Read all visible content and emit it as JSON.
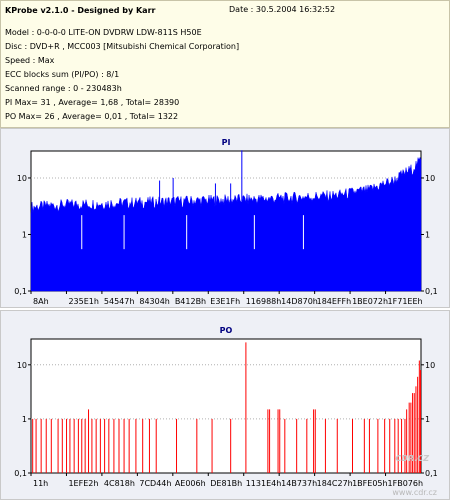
{
  "header": {
    "title": "KProbe v2.1.0 - Designed by Karr",
    "date": "Date : 30.5.2004 16:32:52",
    "model": "Model : 0-0-0-0 LITE-ON DVDRW LDW-811S   H50E",
    "disc": "Disc : DVD+R , MCC003 [Mitsubishi Chemical Corporation]",
    "speed": "Speed : Max",
    "ecc": "ECC blocks sum (PI/PO) : 8/1",
    "range": "Scanned range : 0 - 230483h",
    "pi_stats": "PI Max= 31 , Average= 1,68 , Total= 28390",
    "po_stats": "PO Max= 26 , Average= 0,01 , Total= 1322"
  },
  "watermark": "CDR.CZ",
  "watermark_url": "www.cdr.cz",
  "colors": {
    "pi": "#0000ff",
    "po": "#ff0000",
    "panel_bg": "#eef0f6",
    "plot_bg": "#ffffff",
    "grid": "#b0b0b0"
  },
  "chart_data": [
    {
      "type": "bar",
      "title": "PI",
      "yscale": "log",
      "ylim": [
        0.1,
        30
      ],
      "y_tick_labels": [
        "10",
        "1",
        "0,1"
      ],
      "y_tick_values": [
        10,
        1,
        0.1
      ],
      "x_tick_labels": [
        "8Ah",
        "235E1h",
        "54547h",
        "84304h",
        "B412Bh",
        "E3E1Fh",
        "116988h",
        "14D870h",
        "184EFFh",
        "1BE072h",
        "1F71EEh"
      ],
      "xlim": [
        0,
        230483
      ],
      "profile": [
        {
          "x": 0,
          "y": 3
        },
        {
          "x": 20000,
          "y": 3.3
        },
        {
          "x": 60000,
          "y": 3.6
        },
        {
          "x": 100000,
          "y": 3.9
        },
        {
          "x": 140000,
          "y": 4.2
        },
        {
          "x": 180000,
          "y": 4.8
        },
        {
          "x": 200000,
          "y": 6
        },
        {
          "x": 215000,
          "y": 9
        },
        {
          "x": 225000,
          "y": 14
        },
        {
          "x": 230483,
          "y": 20
        }
      ],
      "spikes": [
        {
          "x": 124600,
          "y": 31
        },
        {
          "x": 76000,
          "y": 9
        },
        {
          "x": 84000,
          "y": 10
        },
        {
          "x": 109000,
          "y": 8
        },
        {
          "x": 118000,
          "y": 8
        }
      ]
    },
    {
      "type": "bar",
      "title": "PO",
      "yscale": "log",
      "ylim": [
        0.1,
        30
      ],
      "y_tick_labels": [
        "10",
        "1",
        "0,1"
      ],
      "y_tick_values": [
        10,
        1,
        0.1
      ],
      "x_tick_labels": [
        "11h",
        "1EFE2h",
        "4C818h",
        "7CD44h",
        "AE006h",
        "DE81Bh",
        "1131E4h",
        "14B737h",
        "184C27h",
        "1BFE05h",
        "1FB076h"
      ],
      "xlim": [
        0,
        230483
      ],
      "bars": [
        {
          "x": 1000,
          "y": 1
        },
        {
          "x": 3000,
          "y": 1
        },
        {
          "x": 6000,
          "y": 1
        },
        {
          "x": 9000,
          "y": 1
        },
        {
          "x": 12000,
          "y": 1
        },
        {
          "x": 16000,
          "y": 1
        },
        {
          "x": 18500,
          "y": 1
        },
        {
          "x": 21000,
          "y": 1
        },
        {
          "x": 23000,
          "y": 1
        },
        {
          "x": 25500,
          "y": 1
        },
        {
          "x": 28000,
          "y": 1
        },
        {
          "x": 30000,
          "y": 1
        },
        {
          "x": 32000,
          "y": 1
        },
        {
          "x": 34000,
          "y": 1.5
        },
        {
          "x": 36000,
          "y": 1
        },
        {
          "x": 38500,
          "y": 1
        },
        {
          "x": 41000,
          "y": 1
        },
        {
          "x": 43500,
          "y": 1
        },
        {
          "x": 46000,
          "y": 1
        },
        {
          "x": 49000,
          "y": 1
        },
        {
          "x": 52000,
          "y": 1
        },
        {
          "x": 55000,
          "y": 1
        },
        {
          "x": 58000,
          "y": 1
        },
        {
          "x": 62000,
          "y": 1
        },
        {
          "x": 66000,
          "y": 1
        },
        {
          "x": 70000,
          "y": 1
        },
        {
          "x": 74000,
          "y": 1
        },
        {
          "x": 86000,
          "y": 1
        },
        {
          "x": 98000,
          "y": 1
        },
        {
          "x": 107000,
          "y": 1
        },
        {
          "x": 118000,
          "y": 1
        },
        {
          "x": 127000,
          "y": 26
        },
        {
          "x": 140000,
          "y": 1.5
        },
        {
          "x": 141000,
          "y": 1.5
        },
        {
          "x": 146000,
          "y": 1.5
        },
        {
          "x": 147000,
          "y": 1.5
        },
        {
          "x": 150000,
          "y": 1
        },
        {
          "x": 157000,
          "y": 1
        },
        {
          "x": 163000,
          "y": 1
        },
        {
          "x": 167000,
          "y": 1.5
        },
        {
          "x": 168000,
          "y": 1.5
        },
        {
          "x": 174000,
          "y": 1
        },
        {
          "x": 181000,
          "y": 1
        },
        {
          "x": 190000,
          "y": 1
        },
        {
          "x": 197000,
          "y": 1
        },
        {
          "x": 200000,
          "y": 1
        },
        {
          "x": 205000,
          "y": 1
        },
        {
          "x": 209000,
          "y": 1
        },
        {
          "x": 212000,
          "y": 1
        },
        {
          "x": 215000,
          "y": 1
        },
        {
          "x": 217000,
          "y": 1
        },
        {
          "x": 219000,
          "y": 1
        },
        {
          "x": 221000,
          "y": 1
        },
        {
          "x": 222000,
          "y": 1.5
        },
        {
          "x": 223500,
          "y": 2
        },
        {
          "x": 224500,
          "y": 2
        },
        {
          "x": 225500,
          "y": 3
        },
        {
          "x": 226500,
          "y": 3
        },
        {
          "x": 227500,
          "y": 4
        },
        {
          "x": 228500,
          "y": 6
        },
        {
          "x": 229500,
          "y": 12
        },
        {
          "x": 230200,
          "y": 8
        }
      ]
    }
  ]
}
